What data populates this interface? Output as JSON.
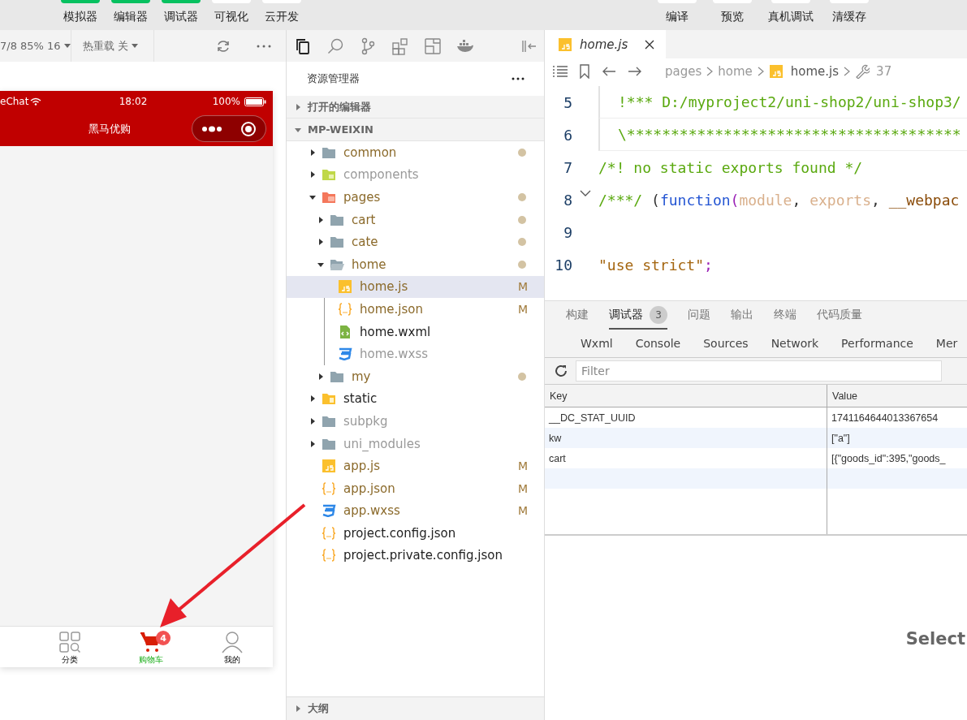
{
  "toolbar": {
    "left": [
      {
        "label": "模拟器",
        "active": true
      },
      {
        "label": "编辑器",
        "active": true
      },
      {
        "label": "调试器",
        "active": true
      },
      {
        "label": "可视化",
        "active": false
      },
      {
        "label": "云开发",
        "active": false
      }
    ],
    "right": [
      {
        "label": "编译",
        "active": false
      },
      {
        "label": "预览",
        "active": false
      },
      {
        "label": "真机调试",
        "active": false
      },
      {
        "label": "清缓存",
        "active": false
      }
    ]
  },
  "simulator": {
    "device_info": "7/8 85% 16",
    "hot_reload": "热重载 关",
    "phone": {
      "carrier": "eChat",
      "time": "18:02",
      "battery": "100%",
      "title": "黑马优购",
      "tabs": [
        {
          "label": "分类",
          "kind": "grid",
          "selected": false
        },
        {
          "label": "购物车",
          "kind": "cart",
          "selected": true,
          "badge": "4"
        },
        {
          "label": "我的",
          "kind": "person",
          "selected": false
        }
      ]
    }
  },
  "explorer": {
    "title": "资源管理器",
    "sections": [
      {
        "label": "打开的编辑器",
        "expanded": false
      },
      {
        "label": "MP-WEIXIN",
        "expanded": true
      }
    ],
    "tree": [
      {
        "name": "common",
        "kind": "folder",
        "expanded": false,
        "selected": false,
        "dot": true,
        "dimmed": false
      },
      {
        "name": "components",
        "kind": "components",
        "expanded": false,
        "selected": false,
        "dot": false,
        "dimmed": true
      },
      {
        "name": "pages",
        "kind": "pages",
        "expanded": true,
        "selected": false,
        "dot": true,
        "dimmed": false,
        "children": [
          {
            "name": "cart",
            "kind": "folder",
            "expanded": false,
            "selected": false,
            "dot": true,
            "dimmed": false
          },
          {
            "name": "cate",
            "kind": "folder",
            "expanded": false,
            "selected": false,
            "dot": true,
            "dimmed": false
          },
          {
            "name": "home",
            "kind": "folder",
            "expanded": true,
            "selected": false,
            "dot": true,
            "dimmed": false,
            "children": [
              {
                "name": "home.js",
                "kind": "js",
                "selected": true,
                "dot": false,
                "dimmed": false,
                "git_mark": "M"
              },
              {
                "name": "home.json",
                "kind": "json",
                "selected": false,
                "dot": false,
                "dimmed": false,
                "git_mark": "M"
              },
              {
                "name": "home.wxml",
                "kind": "wxml",
                "selected": false,
                "dot": false,
                "dimmed": false
              },
              {
                "name": "home.wxss",
                "kind": "wxss",
                "selected": false,
                "dot": false,
                "dimmed": true
              }
            ]
          },
          {
            "name": "my",
            "kind": "folder",
            "expanded": false,
            "selected": false,
            "dot": true,
            "dimmed": false
          }
        ]
      },
      {
        "name": "static",
        "kind": "static",
        "expanded": false,
        "selected": false,
        "dot": false,
        "dimmed": false
      },
      {
        "name": "subpkg",
        "kind": "folder",
        "expanded": false,
        "selected": false,
        "dot": false,
        "dimmed": true
      },
      {
        "name": "uni_modules",
        "kind": "folder",
        "expanded": false,
        "selected": false,
        "dot": false,
        "dimmed": true
      },
      {
        "name": "app.js",
        "kind": "js",
        "selected": false,
        "dot": false,
        "dimmed": false,
        "git_mark": "M"
      },
      {
        "name": "app.json",
        "kind": "json",
        "selected": false,
        "dot": false,
        "dimmed": false,
        "git_mark": "M"
      },
      {
        "name": "app.wxss",
        "kind": "wxss",
        "selected": false,
        "dot": false,
        "dimmed": false,
        "git_mark": "M"
      },
      {
        "name": "project.config.json",
        "kind": "json",
        "selected": false,
        "dot": false,
        "dimmed": false
      },
      {
        "name": "project.private.config.json",
        "kind": "json",
        "selected": false,
        "dot": false,
        "dimmed": false
      }
    ],
    "outline": {
      "label": "大纲",
      "expanded": false
    }
  },
  "editor": {
    "tab": {
      "label": "home.js"
    },
    "breadcrumb": [
      "pages",
      "home",
      "home.js"
    ],
    "symbol": "37",
    "lines": [
      {
        "number": "5",
        "fold": false,
        "boxed": true,
        "tokens": [
          {
            "kind": "comment",
            "text": "!*** D:/myproject2/uni-shop2/uni-shop3/"
          }
        ]
      },
      {
        "number": "6",
        "fold": false,
        "boxed": true,
        "tokens": [
          {
            "kind": "comment",
            "text": "\\**************************************"
          }
        ]
      },
      {
        "number": "7",
        "fold": false,
        "boxed": false,
        "tokens": [
          {
            "kind": "comment",
            "text": "/*! no static exports found */"
          }
        ]
      },
      {
        "number": "8",
        "fold": true,
        "boxed": false,
        "tokens": [
          {
            "kind": "comment",
            "text": "/***/"
          },
          {
            "kind": "plain",
            "text": " ("
          },
          {
            "kind": "keyword",
            "text": "function"
          },
          {
            "kind": "paren",
            "text": "("
          },
          {
            "kind": "param",
            "text": "module"
          },
          {
            "kind": "plain",
            "text": ", "
          },
          {
            "kind": "param",
            "text": "exports"
          },
          {
            "kind": "plain",
            "text": ", "
          },
          {
            "kind": "variable",
            "text": "__webpac"
          }
        ]
      },
      {
        "number": "9",
        "fold": false,
        "boxed": false
      },
      {
        "number": "10",
        "fold": false,
        "boxed": false,
        "tokens": [
          {
            "kind": "string",
            "text": "\"use strict\""
          },
          {
            "kind": "paren",
            "text": ";"
          }
        ]
      }
    ]
  },
  "devtools": {
    "tabs": [
      {
        "label": "构建",
        "selected": false
      },
      {
        "label": "调试器",
        "selected": true,
        "badge": "3"
      },
      {
        "label": "问题",
        "selected": false
      },
      {
        "label": "输出",
        "selected": false
      },
      {
        "label": "终端",
        "selected": false
      },
      {
        "label": "代码质量",
        "selected": false
      }
    ],
    "panels": [
      "Wxml",
      "Console",
      "Sources",
      "Network",
      "Performance",
      "Mer"
    ],
    "filter": {
      "placeholder": "Filter"
    },
    "table": {
      "columns": [
        "Key",
        "Value"
      ],
      "rows": [
        [
          "__DC_STAT_UUID",
          "1741164644013367654"
        ],
        [
          "kw",
          "[\"a\"]"
        ],
        [
          "cart",
          "[{\"goods_id\":395,\"goods_"
        ]
      ]
    },
    "empty_message": "Select"
  }
}
